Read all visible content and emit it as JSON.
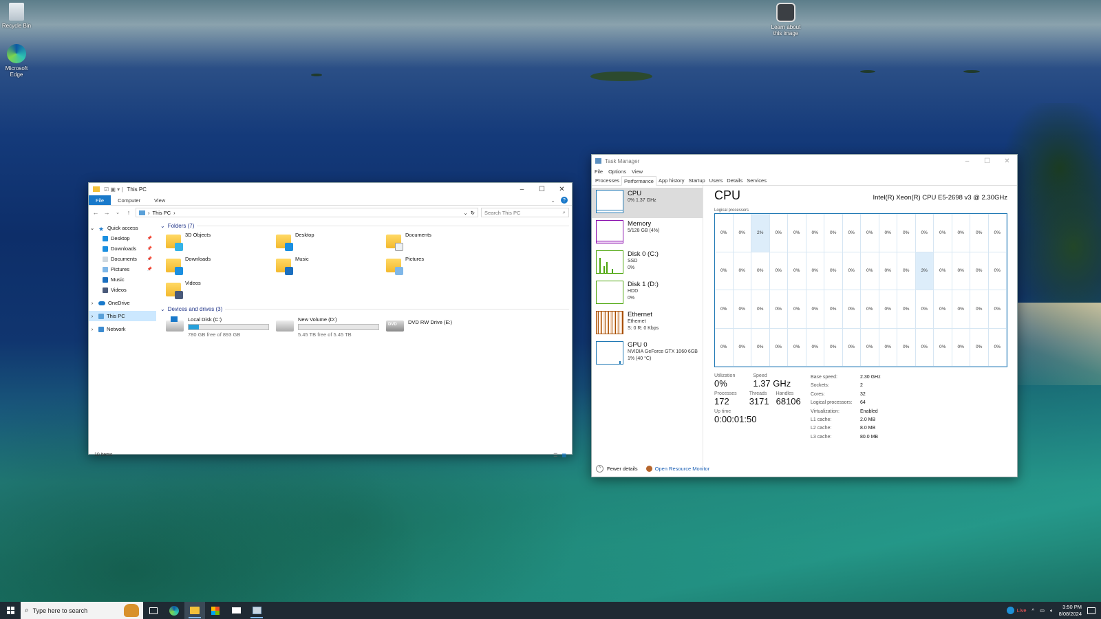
{
  "desktop": {
    "icons": [
      {
        "label": "Recycle Bin"
      },
      {
        "label": "Microsoft Edge"
      },
      {
        "label": "Learn about this image"
      }
    ]
  },
  "explorer": {
    "title": "This PC",
    "ribbon_tabs": [
      "File",
      "Computer",
      "View"
    ],
    "address": "This PC",
    "search_placeholder": "Search This PC",
    "nav": {
      "quick_access": "Quick access",
      "qa_items": [
        "Desktop",
        "Downloads",
        "Documents",
        "Pictures",
        "Music",
        "Videos"
      ],
      "onedrive": "OneDrive",
      "this_pc": "This PC",
      "network": "Network"
    },
    "folders_header": "Folders (7)",
    "folders": [
      "3D Objects",
      "Desktop",
      "Documents",
      "Downloads",
      "Music",
      "Pictures",
      "Videos"
    ],
    "devices_header": "Devices and drives (3)",
    "drives": [
      {
        "name": "Local Disk (C:)",
        "free": "780 GB free of 893 GB",
        "used_fraction": 0.127
      },
      {
        "name": "New Volume (D:)",
        "free": "5.45 TB free of 5.45 TB",
        "used_fraction": 0.0
      },
      {
        "name": "DVD RW Drive (E:)"
      }
    ],
    "status": "10 items"
  },
  "taskmgr": {
    "title": "Task Manager",
    "menu": [
      "File",
      "Options",
      "View"
    ],
    "tabs": [
      "Processes",
      "Performance",
      "App history",
      "Startup",
      "Users",
      "Details",
      "Services"
    ],
    "sidebar": [
      {
        "name": "CPU",
        "l1": "0%  1.37 GHz",
        "color": "#1f78b4"
      },
      {
        "name": "Memory",
        "l1": "5/128 GB (4%)",
        "color": "#8b12ae"
      },
      {
        "name": "Disk 0 (C:)",
        "l1": "SSD",
        "l2": "0%",
        "color": "#4da60c"
      },
      {
        "name": "Disk 1 (D:)",
        "l1": "HDD",
        "l2": "0%",
        "color": "#4da60c"
      },
      {
        "name": "Ethernet",
        "l1": "Ethernet",
        "l2": "S: 0  R: 0 Kbps",
        "color": "#a74f01"
      },
      {
        "name": "GPU 0",
        "l1": "NVIDIA GeForce GTX 1060 6GB",
        "l2": "1% (40 °C)",
        "color": "#1f78b4"
      }
    ],
    "heading": "CPU",
    "cpu_name": "Intel(R) Xeon(R) CPU E5-2698 v3 @ 2.30GHz",
    "logical_label": "Logical processors",
    "logical_values": [
      "0%",
      "0%",
      "2%",
      "0%",
      "0%",
      "0%",
      "0%",
      "0%",
      "0%",
      "0%",
      "0%",
      "0%",
      "0%",
      "0%",
      "0%",
      "0%",
      "0%",
      "0%",
      "0%",
      "0%",
      "0%",
      "0%",
      "0%",
      "0%",
      "0%",
      "0%",
      "0%",
      "3%",
      "0%",
      "0%",
      "0%",
      "0%",
      "0%",
      "0%",
      "0%",
      "0%",
      "0%",
      "0%",
      "0%",
      "0%",
      "0%",
      "0%",
      "0%",
      "0%",
      "0%",
      "0%",
      "0%",
      "0%",
      "0%",
      "0%",
      "0%",
      "0%",
      "0%",
      "0%",
      "0%",
      "0%",
      "0%",
      "0%",
      "0%",
      "0%",
      "0%",
      "0%",
      "0%",
      "0%"
    ],
    "stats": {
      "utilization_label": "Utilization",
      "utilization": "0%",
      "speed_label": "Speed",
      "speed": "1.37 GHz",
      "processes_label": "Processes",
      "processes": "172",
      "threads_label": "Threads",
      "threads": "3171",
      "handles_label": "Handles",
      "handles": "68106",
      "uptime_label": "Up time",
      "uptime": "0:00:01:50"
    },
    "specs": [
      {
        "k": "Base speed:",
        "v": "2.30 GHz"
      },
      {
        "k": "Sockets:",
        "v": "2"
      },
      {
        "k": "Cores:",
        "v": "32"
      },
      {
        "k": "Logical processors:",
        "v": "64"
      },
      {
        "k": "Virtualization:",
        "v": "Enabled"
      },
      {
        "k": "L1 cache:",
        "v": "2.0 MB"
      },
      {
        "k": "L2 cache:",
        "v": "8.0 MB"
      },
      {
        "k": "L3 cache:",
        "v": "80.0 MB"
      }
    ],
    "fewer_details": "Fewer details",
    "open_rm": "Open Resource Monitor"
  },
  "taskbar": {
    "search_placeholder": "Type here to search",
    "live_label": "Live",
    "time": "3:50 PM",
    "date": "8/08/2024"
  }
}
